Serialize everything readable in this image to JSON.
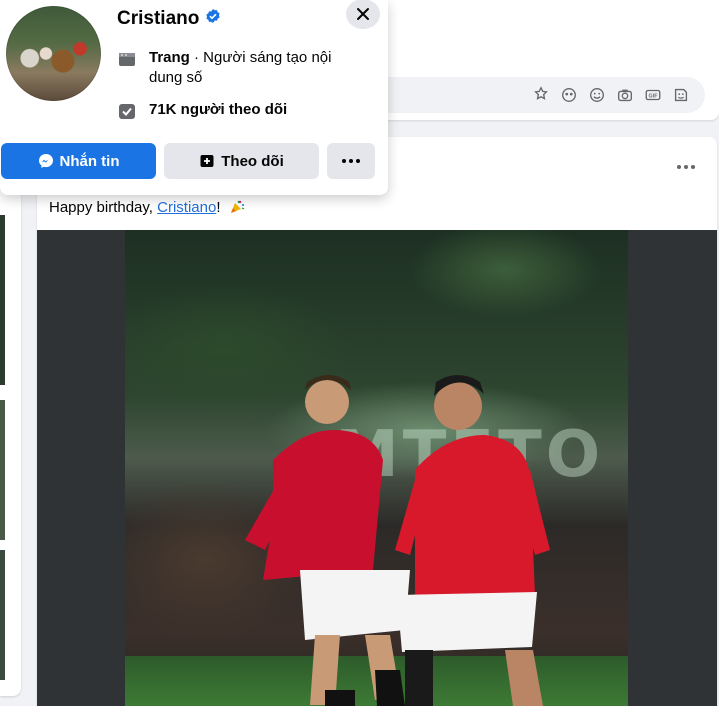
{
  "profile_card": {
    "name": "Cristiano",
    "verified_icon": "verified-badge-icon",
    "page_type_label": "Trang",
    "page_category": "· Người sáng tạo nội dung số",
    "followers_text": "71K người theo dõi",
    "buttons": {
      "message_label": "Nhắn tin",
      "follow_label": "Theo dõi",
      "more_icon": "more-horizontal-icon"
    },
    "close_icon": "close-icon"
  },
  "comment_bar": {
    "icons": [
      "avatar-sticker-icon",
      "emoji-reaction-icon",
      "smiley-icon",
      "camera-icon",
      "gif-icon",
      "sticker-icon"
    ]
  },
  "post": {
    "text_prefix": "Happy birthday, ",
    "mention": "Cristiano",
    "text_suffix": "!",
    "emoji": "party-popper-icon",
    "image_alt": "Cristiano Ronaldo young and older in Manchester United kits",
    "stadium_lettering": "MTETO"
  },
  "colors": {
    "primary": "#1b74e4",
    "secondary_button": "#e4e6eb",
    "link": "#216fdb",
    "background": "#f0f2f5"
  }
}
